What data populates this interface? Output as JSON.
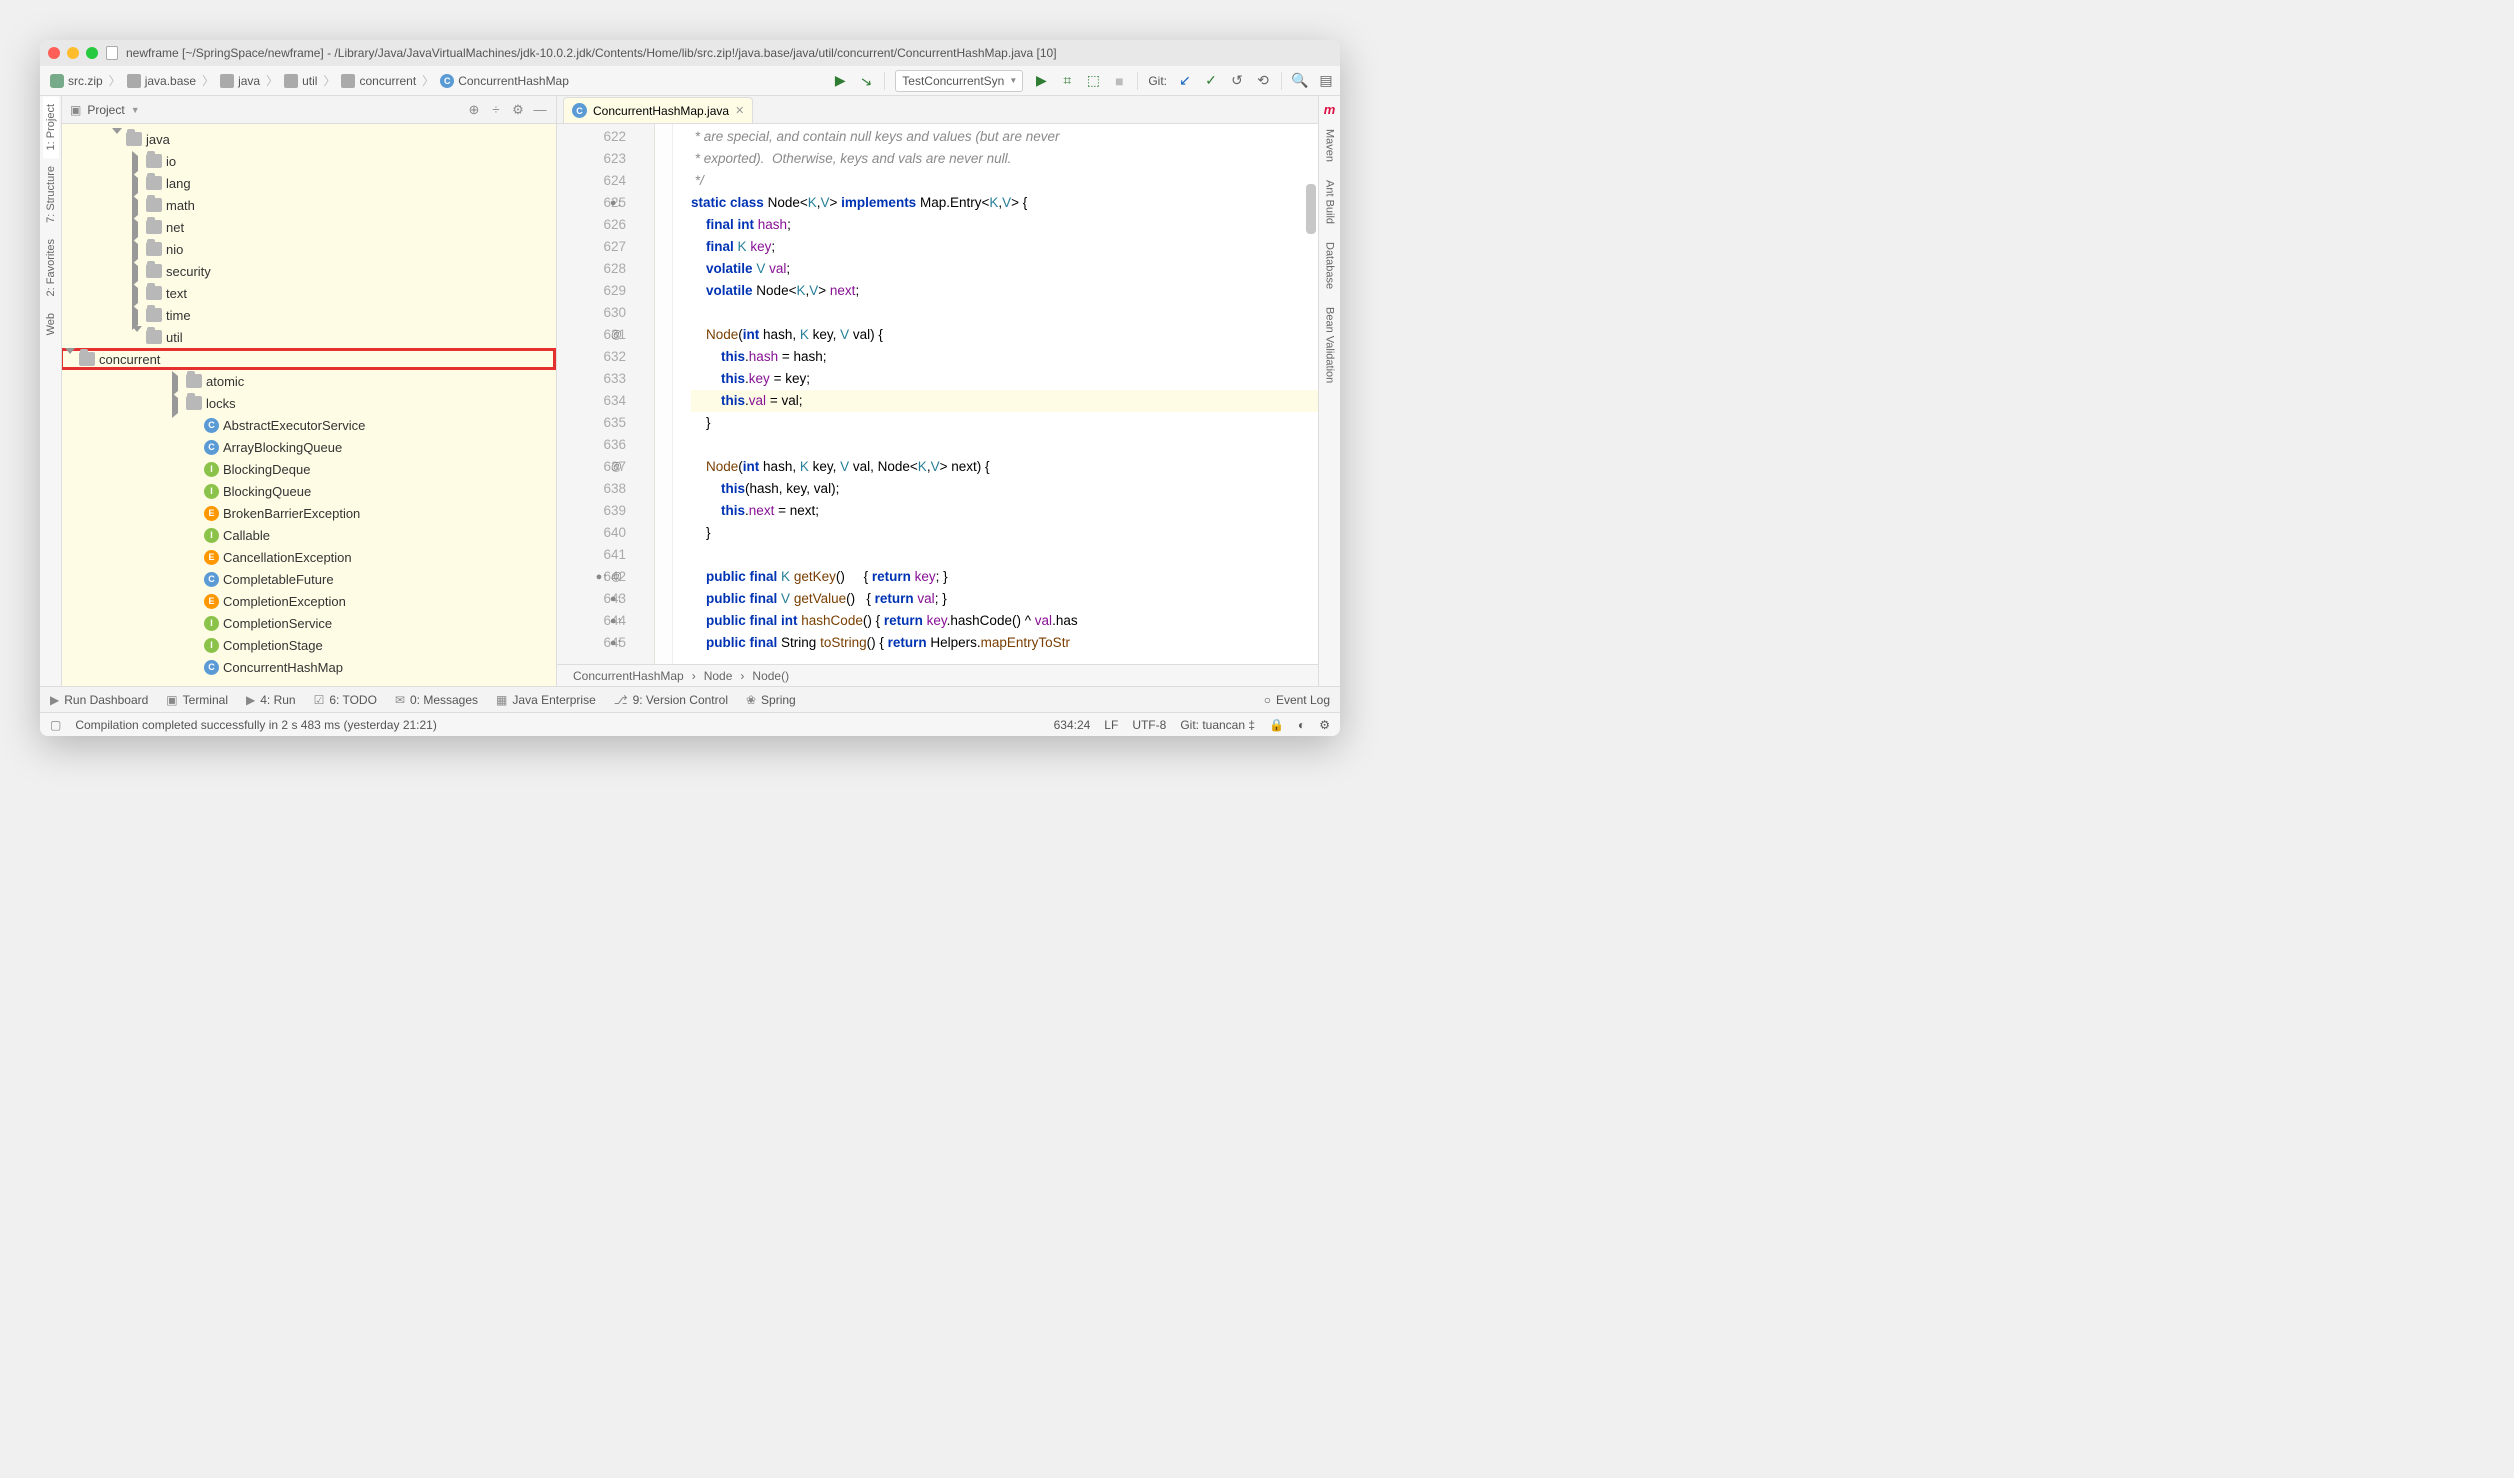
{
  "window_title": "newframe [~/SpringSpace/newframe] - /Library/Java/JavaVirtualMachines/jdk-10.0.2.jdk/Contents/Home/lib/src.zip!/java.base/java/util/concurrent/ConcurrentHashMap.java [10]",
  "breadcrumbs": [
    "src.zip",
    "java.base",
    "java",
    "util",
    "concurrent",
    "ConcurrentHashMap"
  ],
  "run_config": "TestConcurrentSyn",
  "git_label": "Git:",
  "project_label": "Project",
  "left_tabs": [
    "1: Project",
    "7: Structure",
    "2: Favorites",
    "Web"
  ],
  "tree": [
    {
      "ind": 50,
      "exp": "down",
      "type": "folder",
      "label": "java"
    },
    {
      "ind": 70,
      "exp": "right",
      "type": "folder",
      "label": "io"
    },
    {
      "ind": 70,
      "exp": "right",
      "type": "folder",
      "label": "lang"
    },
    {
      "ind": 70,
      "exp": "right",
      "type": "folder",
      "label": "math"
    },
    {
      "ind": 70,
      "exp": "right",
      "type": "folder",
      "label": "net"
    },
    {
      "ind": 70,
      "exp": "right",
      "type": "folder",
      "label": "nio"
    },
    {
      "ind": 70,
      "exp": "right",
      "type": "folder",
      "label": "security"
    },
    {
      "ind": 70,
      "exp": "right",
      "type": "folder",
      "label": "text"
    },
    {
      "ind": 70,
      "exp": "right",
      "type": "folder",
      "label": "time"
    },
    {
      "ind": 70,
      "exp": "down",
      "type": "folder",
      "label": "util"
    },
    {
      "ind": 90,
      "exp": "down",
      "type": "folder",
      "label": "concurrent",
      "hl": true
    },
    {
      "ind": 110,
      "exp": "right",
      "type": "folder",
      "label": "atomic"
    },
    {
      "ind": 110,
      "exp": "right",
      "type": "folder",
      "label": "locks"
    },
    {
      "ind": 128,
      "type": "c",
      "label": "AbstractExecutorService"
    },
    {
      "ind": 128,
      "type": "c",
      "label": "ArrayBlockingQueue"
    },
    {
      "ind": 128,
      "type": "i",
      "label": "BlockingDeque"
    },
    {
      "ind": 128,
      "type": "i",
      "label": "BlockingQueue"
    },
    {
      "ind": 128,
      "type": "e",
      "label": "BrokenBarrierException"
    },
    {
      "ind": 128,
      "type": "i",
      "label": "Callable"
    },
    {
      "ind": 128,
      "type": "e",
      "label": "CancellationException"
    },
    {
      "ind": 128,
      "type": "c",
      "label": "CompletableFuture"
    },
    {
      "ind": 128,
      "type": "e",
      "label": "CompletionException"
    },
    {
      "ind": 128,
      "type": "i",
      "label": "CompletionService"
    },
    {
      "ind": 128,
      "type": "i",
      "label": "CompletionStage"
    },
    {
      "ind": 128,
      "type": "c",
      "label": "ConcurrentHashMap"
    }
  ],
  "editor_tab": "ConcurrentHashMap.java",
  "gutter_start": 622,
  "code_lines": [
    {
      "n": 622,
      "html": "<span class='cm'> * are special, and contain null keys and values (but are never</span>"
    },
    {
      "n": 623,
      "html": "<span class='cm'> * exported).  Otherwise, keys and vals are never null.</span>"
    },
    {
      "n": 624,
      "html": "<span class='cm'> */</span>"
    },
    {
      "n": 625,
      "html": "<span class='kw'>static class</span> Node&lt;<span class='ty'>K</span>,<span class='ty'>V</span>&gt; <span class='kw'>implements</span> Map.Entry&lt;<span class='ty'>K</span>,<span class='ty'>V</span>&gt; {",
      "mark": "●↓"
    },
    {
      "n": 626,
      "html": "    <span class='kw'>final int</span> <span class='fd'>hash</span>;"
    },
    {
      "n": 627,
      "html": "    <span class='kw'>final</span> <span class='ty'>K</span> <span class='fd'>key</span>;"
    },
    {
      "n": 628,
      "html": "    <span class='kw'>volatile</span> <span class='ty'>V</span> <span class='fd'>val</span>;"
    },
    {
      "n": 629,
      "html": "    <span class='kw'>volatile</span> Node&lt;<span class='ty'>K</span>,<span class='ty'>V</span>&gt; <span class='fd'>next</span>;"
    },
    {
      "n": 630,
      "html": " "
    },
    {
      "n": 631,
      "html": "    <span class='fn'>Node</span>(<span class='kw'>int</span> hash, <span class='ty'>K</span> key, <span class='ty'>V</span> val) {",
      "mark": "@"
    },
    {
      "n": 632,
      "html": "        <span class='kw'>this</span>.<span class='fd'>hash</span> = hash;"
    },
    {
      "n": 633,
      "html": "        <span class='kw'>this</span>.<span class='fd'>key</span> = key;"
    },
    {
      "n": 634,
      "html": "        <span class='kw'>this</span>.<span class='fd'>val</span> = val;",
      "hl": true
    },
    {
      "n": 635,
      "html": "    }"
    },
    {
      "n": 636,
      "html": " "
    },
    {
      "n": 637,
      "html": "    <span class='fn'>Node</span>(<span class='kw'>int</span> hash, <span class='ty'>K</span> key, <span class='ty'>V</span> val, Node&lt;<span class='ty'>K</span>,<span class='ty'>V</span>&gt; next) {",
      "mark": "@"
    },
    {
      "n": 638,
      "html": "        <span class='kw'>this</span>(hash, key, val);"
    },
    {
      "n": 639,
      "html": "        <span class='kw'>this</span>.<span class='fd'>next</span> = next;"
    },
    {
      "n": 640,
      "html": "    }"
    },
    {
      "n": 641,
      "html": " "
    },
    {
      "n": 642,
      "html": "    <span class='kw'>public final</span> <span class='ty'>K</span> <span class='fn'>getKey</span>()     { <span class='kw'>return</span> <span class='fd'>key</span>; }",
      "mark": "●↑ @"
    },
    {
      "n": 643,
      "html": "    <span class='kw'>public final</span> <span class='ty'>V</span> <span class='fn'>getValue</span>()   { <span class='kw'>return</span> <span class='fd'>val</span>; }",
      "mark": "●↑"
    },
    {
      "n": 644,
      "html": "    <span class='kw'>public final int</span> <span class='fn'>hashCode</span>() { <span class='kw'>return</span> <span class='fd'>key</span>.hashCode() ^ <span class='fd'>val</span>.has",
      "mark": "●↑"
    },
    {
      "n": 645,
      "html": "    <span class='kw'>public final</span> String <span class='fn'>toString</span>() { <span class='kw'>return</span> Helpers.<span class='fn'>mapEntryToStr</span>",
      "mark": "●↑"
    }
  ],
  "editor_crumbs": [
    "ConcurrentHashMap",
    "Node",
    "Node()"
  ],
  "right_tabs": [
    "Maven",
    "Ant Build",
    "Database",
    "Bean Validation"
  ],
  "bottom_tools": [
    "Run Dashboard",
    "Terminal",
    "4: Run",
    "6: TODO",
    "0: Messages",
    "Java Enterprise",
    "9: Version Control",
    "Spring"
  ],
  "event_log": "Event Log",
  "status_msg": "Compilation completed successfully in 2 s 483 ms (yesterday 21:21)",
  "status_pos": "634:24",
  "status_sep": "LF",
  "status_enc": "UTF-8",
  "status_git": "Git: tuancan ‡",
  "right_icon_m": "m"
}
